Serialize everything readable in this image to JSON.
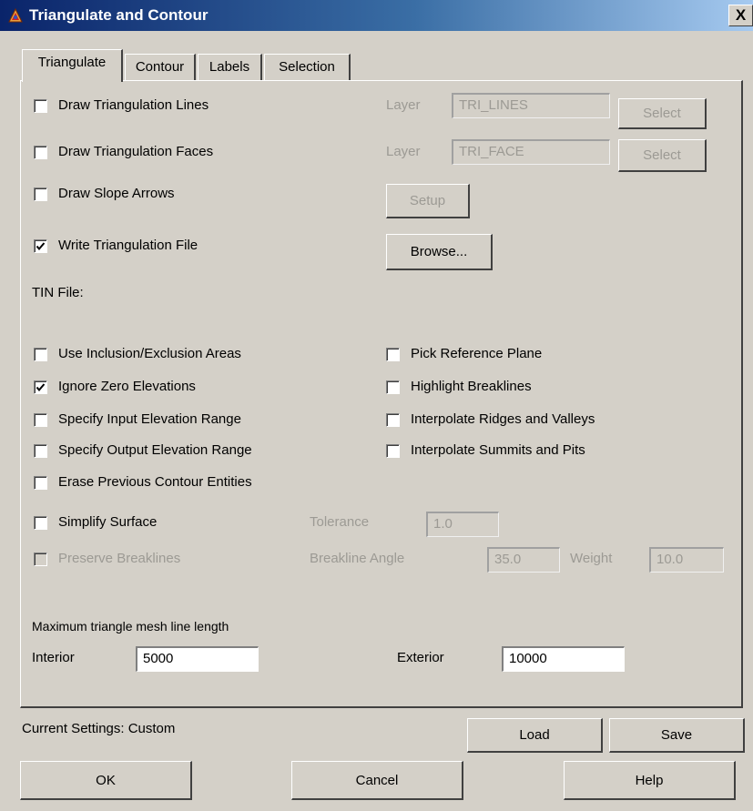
{
  "window": {
    "title": "Triangulate and Contour",
    "close_glyph": "X",
    "icon": "app-icon"
  },
  "tabs": [
    {
      "label": "Triangulate",
      "active": true
    },
    {
      "label": "Contour",
      "active": false
    },
    {
      "label": "Labels",
      "active": false
    },
    {
      "label": "Selection",
      "active": false
    }
  ],
  "triangulate": {
    "draw_lines": {
      "label": "Draw Triangulation Lines",
      "checked": false,
      "layer_label": "Layer",
      "layer_value": "TRI_LINES",
      "select_label": "Select"
    },
    "draw_faces": {
      "label": "Draw Triangulation Faces",
      "checked": false,
      "layer_label": "Layer",
      "layer_value": "TRI_FACE",
      "select_label": "Select"
    },
    "slope_arrows": {
      "label": "Draw Slope Arrows",
      "checked": false,
      "setup_label": "Setup"
    },
    "write_file": {
      "label": "Write Triangulation File",
      "checked": true,
      "browse_label": "Browse..."
    },
    "tin_file_label": "TIN File:",
    "options_left": [
      {
        "label": "Use Inclusion/Exclusion Areas",
        "checked": false
      },
      {
        "label": "Ignore Zero Elevations",
        "checked": true
      },
      {
        "label": "Specify Input Elevation Range",
        "checked": false
      },
      {
        "label": "Specify Output Elevation Range",
        "checked": false
      },
      {
        "label": "Erase Previous Contour Entities",
        "checked": false
      }
    ],
    "options_right": [
      {
        "label": "Pick Reference Plane",
        "checked": false
      },
      {
        "label": "Highlight Breaklines",
        "checked": false
      },
      {
        "label": "Interpolate Ridges and Valleys",
        "checked": false
      },
      {
        "label": "Interpolate Summits and Pits",
        "checked": false
      }
    ],
    "simplify": {
      "label": "Simplify Surface",
      "checked": false,
      "tolerance_label": "Tolerance",
      "tolerance_value": "1.0"
    },
    "preserve": {
      "label": "Preserve Breaklines",
      "checked": false,
      "disabled": true,
      "angle_label": "Breakline Angle",
      "angle_value": "35.0",
      "weight_label": "Weight",
      "weight_value": "10.0"
    },
    "mesh": {
      "heading": "Maximum triangle mesh line length",
      "interior_label": "Interior",
      "interior_value": "5000",
      "exterior_label": "Exterior",
      "exterior_value": "10000"
    }
  },
  "footer": {
    "current_settings": "Current Settings: Custom",
    "load_label": "Load",
    "save_label": "Save",
    "ok_label": "OK",
    "cancel_label": "Cancel",
    "help_label": "Help"
  }
}
